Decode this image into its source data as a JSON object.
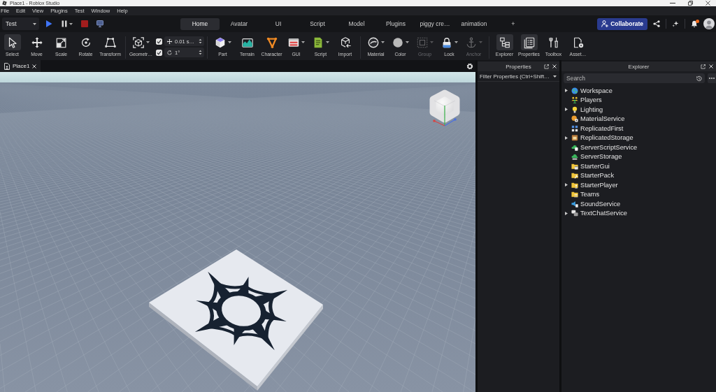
{
  "window": {
    "title": "Place1 - Roblox Studio"
  },
  "menu_bar": [
    "File",
    "Edit",
    "View",
    "Plugins",
    "Test",
    "Window",
    "Help"
  ],
  "test_controls": {
    "mode": "Test"
  },
  "ribbon_tabs": [
    {
      "label": "Home",
      "selected": true
    },
    {
      "label": "Avatar",
      "selected": false
    },
    {
      "label": "UI",
      "selected": false
    },
    {
      "label": "Script",
      "selected": false
    },
    {
      "label": "Model",
      "selected": false
    },
    {
      "label": "Plugins",
      "selected": false
    },
    {
      "label": "piggy cre…",
      "selected": false
    },
    {
      "label": "animation",
      "selected": false
    }
  ],
  "add_tab": "+",
  "collaborate_button": "Collaborate",
  "notifications": {
    "unread": true
  },
  "ribbon": {
    "sections": [
      {
        "kind": "tools",
        "tools": [
          {
            "label": "Select",
            "selected": true,
            "disabled": false,
            "dropdown": false
          },
          {
            "label": "Move",
            "selected": false,
            "disabled": false,
            "dropdown": false
          },
          {
            "label": "Scale",
            "selected": false,
            "disabled": false,
            "dropdown": false
          },
          {
            "label": "Rotate",
            "selected": false,
            "disabled": false,
            "dropdown": false
          },
          {
            "label": "Transform",
            "selected": false,
            "disabled": false,
            "dropdown": false
          }
        ]
      },
      {
        "kind": "snap",
        "tools": [
          {
            "label": "Geometr…",
            "selected": false,
            "disabled": false,
            "dropdown": true
          }
        ],
        "snaps": [
          {
            "checked": true,
            "value": "0.01 s…"
          },
          {
            "checked": true,
            "value": "1°"
          }
        ]
      },
      {
        "kind": "tools",
        "tools": [
          {
            "label": "Part",
            "selected": false,
            "disabled": false,
            "dropdown": true
          },
          {
            "label": "Terrain",
            "selected": false,
            "disabled": false,
            "dropdown": false
          },
          {
            "label": "Character",
            "selected": false,
            "disabled": false,
            "dropdown": false
          },
          {
            "label": "GUI",
            "selected": false,
            "disabled": false,
            "dropdown": true
          },
          {
            "label": "Script",
            "selected": false,
            "disabled": false,
            "dropdown": true
          },
          {
            "label": "Import",
            "selected": false,
            "disabled": false,
            "dropdown": false
          }
        ]
      },
      {
        "kind": "tools",
        "tools": [
          {
            "label": "Material",
            "selected": false,
            "disabled": false,
            "dropdown": true
          },
          {
            "label": "Color",
            "selected": false,
            "disabled": false,
            "dropdown": true
          },
          {
            "label": "Group",
            "selected": false,
            "disabled": true,
            "dropdown": true
          },
          {
            "label": "Lock",
            "selected": false,
            "disabled": false,
            "dropdown": true
          },
          {
            "label": "Anchor",
            "selected": false,
            "disabled": true,
            "dropdown": true
          }
        ]
      },
      {
        "kind": "tools",
        "tools": [
          {
            "label": "Explorer",
            "selected": true,
            "disabled": false,
            "dropdown": false
          },
          {
            "label": "Properties",
            "selected": true,
            "disabled": false,
            "dropdown": false
          },
          {
            "label": "Toolbox",
            "selected": false,
            "disabled": false,
            "dropdown": false
          },
          {
            "label": "Asset…",
            "selected": false,
            "disabled": false,
            "dropdown": false
          }
        ]
      }
    ]
  },
  "document_tabs": [
    {
      "label": "Place1",
      "selected": true
    }
  ],
  "properties": {
    "title": "Properties",
    "filter": {
      "placeholder": "Filter Properties (Ctrl+Shift…"
    }
  },
  "explorer": {
    "title": "Explorer",
    "search": {
      "placeholder": "Search"
    },
    "items": [
      {
        "name": "Workspace",
        "has_children": true
      },
      {
        "name": "Players",
        "has_children": false
      },
      {
        "name": "Lighting",
        "has_children": true
      },
      {
        "name": "MaterialService",
        "has_children": false
      },
      {
        "name": "ReplicatedFirst",
        "has_children": false
      },
      {
        "name": "ReplicatedStorage",
        "has_children": true
      },
      {
        "name": "ServerScriptService",
        "has_children": false
      },
      {
        "name": "ServerStorage",
        "has_children": false
      },
      {
        "name": "StarterGui",
        "has_children": false
      },
      {
        "name": "StarterPack",
        "has_children": false
      },
      {
        "name": "StarterPlayer",
        "has_children": true
      },
      {
        "name": "Teams",
        "has_children": false
      },
      {
        "name": "SoundService",
        "has_children": false
      },
      {
        "name": "TextChatService",
        "has_children": true
      }
    ]
  }
}
